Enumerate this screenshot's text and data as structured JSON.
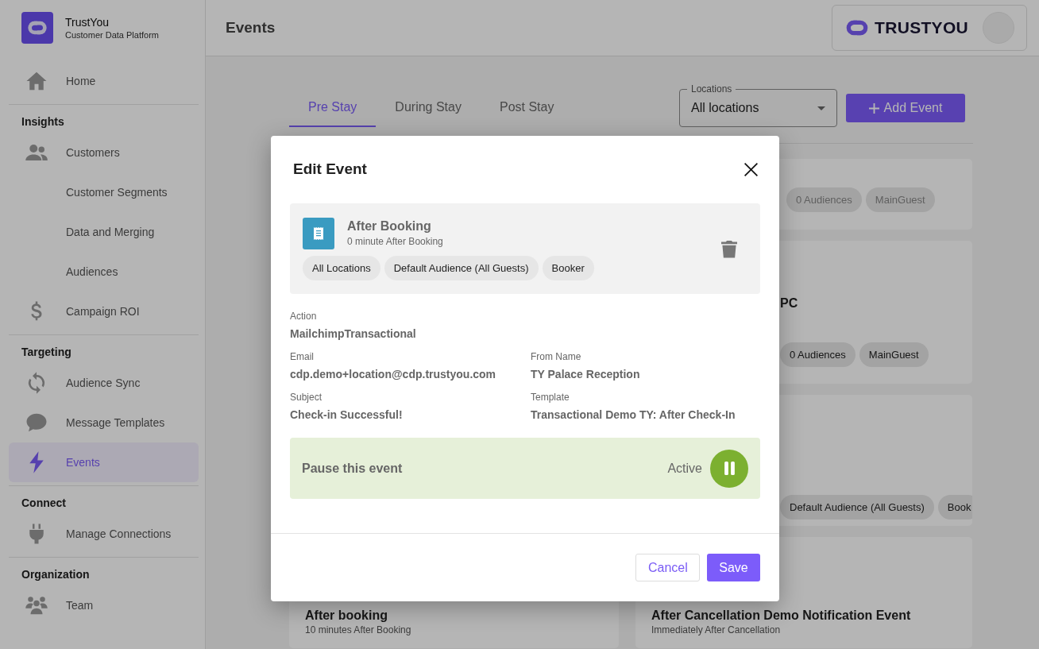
{
  "app": {
    "name": "TrustYou",
    "subtitle": "Customer Data Platform"
  },
  "sidebar": {
    "sections": [
      {
        "items": [
          {
            "label": "Home",
            "selected": false
          }
        ]
      },
      {
        "heading": "Insights",
        "items": [
          {
            "label": "Customers",
            "selected": false
          },
          {
            "label": "Customer Segments",
            "selected": false
          },
          {
            "label": "Data and Merging",
            "selected": false
          },
          {
            "label": "Audiences",
            "selected": false
          },
          {
            "label": "Campaign ROI",
            "selected": false
          }
        ]
      },
      {
        "heading": "Targeting",
        "items": [
          {
            "label": "Audience Sync",
            "selected": false
          },
          {
            "label": "Message Templates",
            "selected": false
          },
          {
            "label": "Events",
            "selected": true
          }
        ]
      },
      {
        "heading": "Connect",
        "items": [
          {
            "label": "Manage Connections",
            "selected": false
          }
        ]
      },
      {
        "heading": "Organization",
        "items": [
          {
            "label": "Team",
            "selected": false
          }
        ]
      }
    ]
  },
  "header": {
    "title": "Events",
    "brand": "TRUSTYOU"
  },
  "tabs": [
    {
      "label": "Pre Stay",
      "selected": true
    },
    {
      "label": "During Stay",
      "selected": false
    },
    {
      "label": "Post Stay",
      "selected": false
    }
  ],
  "location_filter": {
    "label": "Locations",
    "value": "All locations"
  },
  "add_button": {
    "label": "Add Event"
  },
  "card_rows": [
    {
      "right": {
        "chips": [
          "0 Audiences",
          "MainGuest"
        ],
        "paused": true
      }
    },
    {
      "right": {
        "title": "PC",
        "chips": [
          "0 Audiences",
          "MainGuest"
        ],
        "paused": false
      }
    },
    {
      "right": {
        "chips": [
          "Default Audience (All Guests)",
          "Book"
        ],
        "paused": false
      }
    },
    {
      "left": {
        "title": "After booking",
        "subtitle": "10 minutes After Booking"
      },
      "right": {
        "title": "After Cancellation Demo Notification Event",
        "subtitle": "Immediately After Cancellation"
      }
    }
  ],
  "dialog": {
    "title": "Edit Event",
    "event": {
      "title": "After Booking",
      "timing": "0 minute After Booking",
      "chips": [
        "All Locations",
        "Default Audience (All Guests)",
        "Booker"
      ]
    },
    "field_rows": [
      [
        {
          "label": "Action",
          "value": "MailchimpTransactional"
        }
      ],
      [
        {
          "label": "Email",
          "value": "cdp.demo+location@cdp.trustyou.com"
        },
        {
          "label": "From Name",
          "value": "TY Palace Reception"
        }
      ],
      [
        {
          "label": "Subject",
          "value": "Check-in Successful!"
        },
        {
          "label": "Template",
          "value": "Transactional Demo TY: After Check-In"
        }
      ]
    ],
    "pause": {
      "label": "Pause this event",
      "status": "Active",
      "active": true
    },
    "buttons": [
      {
        "label": "Cancel",
        "kind": "secondary"
      },
      {
        "label": "Save",
        "kind": "primary"
      }
    ]
  }
}
